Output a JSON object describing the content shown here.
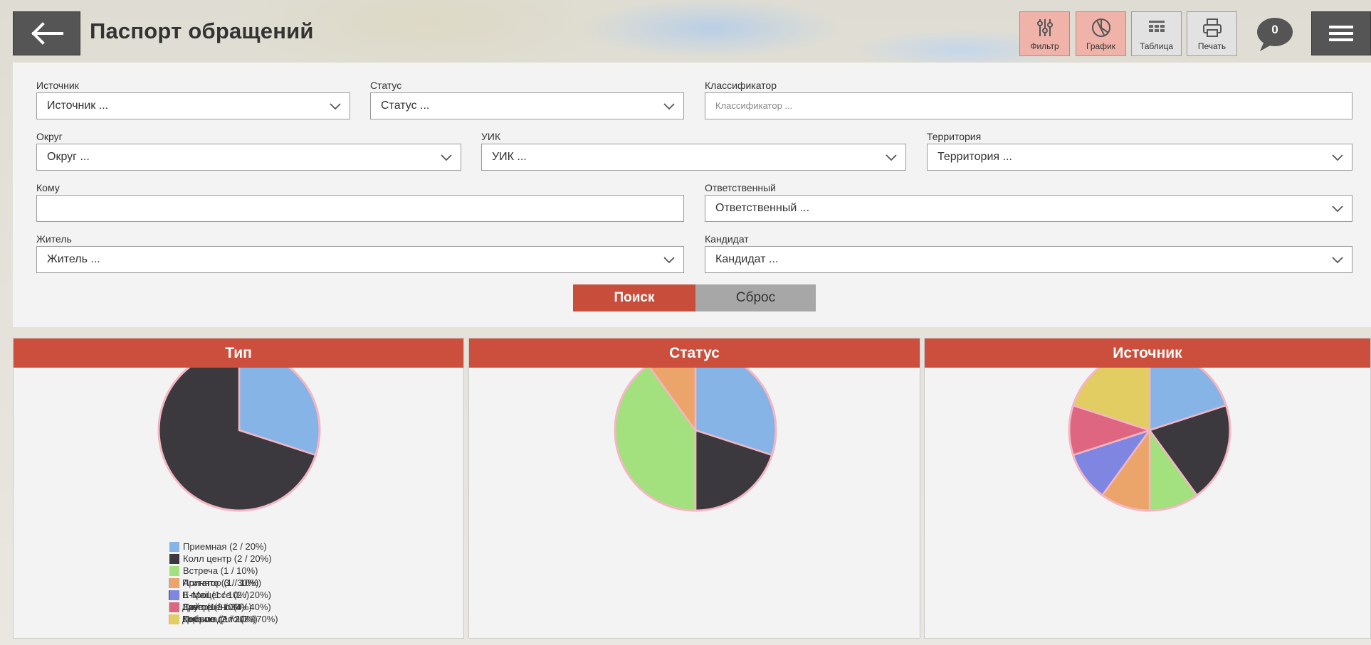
{
  "header": {
    "title": "Паспорт обращений",
    "toolbar": {
      "filter_label": "Фильтр",
      "chart_label": "График",
      "table_label": "Таблица",
      "print_label": "Печать"
    },
    "messages_count": "0"
  },
  "filters": {
    "source": {
      "label": "Источник",
      "value": "Источник ..."
    },
    "status": {
      "label": "Статус",
      "value": "Статус ..."
    },
    "classifier": {
      "label": "Классификатор",
      "placeholder": "Классификатор ..."
    },
    "district": {
      "label": "Округ",
      "value": "Округ ..."
    },
    "uik": {
      "label": "УИК",
      "value": "УИК ..."
    },
    "territory": {
      "label": "Территория",
      "value": "Территория ..."
    },
    "to_whom": {
      "label": "Кому",
      "value": ""
    },
    "responsible": {
      "label": "Ответственный",
      "value": "Ответственный ..."
    },
    "resident": {
      "label": "Житель",
      "value": "Житель ..."
    },
    "candidate": {
      "label": "Кандидат",
      "value": "Кандидат ..."
    },
    "search_button": "Поиск",
    "reset_button": "Сброс"
  },
  "chart_data": [
    {
      "type": "pie",
      "title": "Тип",
      "series": [
        {
          "name": "Другое",
          "value": 3,
          "percent": 30,
          "legend": "Другое (3 / 30%)",
          "color": "#86b4e6"
        },
        {
          "name": "Доброе дело",
          "value": 7,
          "percent": 70,
          "legend": "Доброе дело (7 / 70%)",
          "color": "#3b393e"
        }
      ]
    },
    {
      "type": "pie",
      "title": "Статус",
      "series": [
        {
          "name": "Принято",
          "value": 3,
          "percent": 30,
          "legend": "Принято (3 / 30%)",
          "color": "#86b4e6"
        },
        {
          "name": "В процессе",
          "value": 2,
          "percent": 20,
          "legend": "В процессе (2 / 20%)",
          "color": "#3b393e"
        },
        {
          "name": "Завершено",
          "value": 4,
          "percent": 40,
          "legend": "Завершено (4 / 40%)",
          "color": "#a2e17e"
        },
        {
          "name": "Корзина",
          "value": 1,
          "percent": 10,
          "legend": "Корзина (1 / 10%)",
          "color": "#eba46a"
        }
      ]
    },
    {
      "type": "pie",
      "title": "Источник",
      "series": [
        {
          "name": "Приемная",
          "value": 2,
          "percent": 20,
          "legend": "Приемная (2 / 20%)",
          "color": "#86b4e6"
        },
        {
          "name": "Колл центр",
          "value": 2,
          "percent": 20,
          "legend": "Колл центр (2 / 20%)",
          "color": "#3b393e"
        },
        {
          "name": "Встреча",
          "value": 1,
          "percent": 10,
          "legend": "Встреча (1 / 10%)",
          "color": "#a2e17e"
        },
        {
          "name": "Агитатор",
          "value": 1,
          "percent": 10,
          "legend": "Агитатор (1 / 10%)",
          "color": "#eba46a"
        },
        {
          "name": "E-Mail",
          "value": 1,
          "percent": 10,
          "legend": "E-Mail (1 / 10%)",
          "color": "#7e86e2"
        },
        {
          "name": "Сайт",
          "value": 1,
          "percent": 10,
          "legend": "Сайт (1 / 10%)",
          "color": "#de6680"
        },
        {
          "name": "Письмо",
          "value": 2,
          "percent": 20,
          "legend": "Письмо (2 / 20%)",
          "color": "#e1cd62"
        }
      ]
    }
  ]
}
